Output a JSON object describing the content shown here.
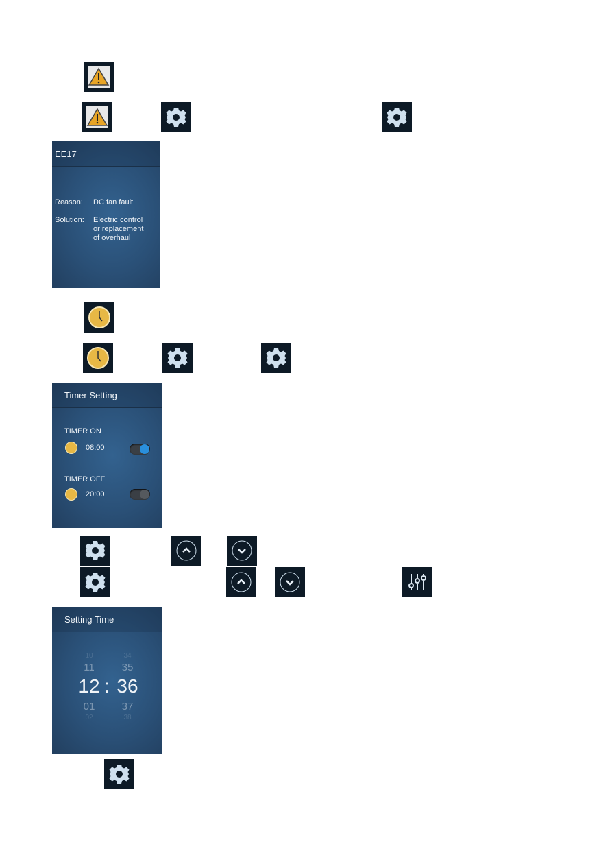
{
  "icons": {
    "warning": "warning-icon",
    "clock": "clock-icon",
    "gear": "gear-icon",
    "up": "chevron-up-icon",
    "down": "chevron-down-icon",
    "sliders": "sliders-icon"
  },
  "error_screen": {
    "title": "EE17",
    "reason_label": "Reason:",
    "reason": "DC fan fault",
    "solution_label": "Solution:",
    "solution_lines": [
      "Electric control",
      "or replacement",
      "of overhaul"
    ]
  },
  "timer_screen": {
    "title": "Timer Setting",
    "timer_on_label": "TIMER ON",
    "timer_on_time": "08:00",
    "timer_on_enabled": true,
    "timer_off_label": "TIMER OFF",
    "timer_off_time": "20:00",
    "timer_off_enabled": false,
    "accent": "#2a8fdc"
  },
  "time_screen": {
    "title": "Setting Time",
    "hours": [
      "10",
      "11",
      "12",
      "01",
      "02"
    ],
    "minutes": [
      "34",
      "35",
      "36",
      "37",
      "38"
    ],
    "separator": ":"
  }
}
